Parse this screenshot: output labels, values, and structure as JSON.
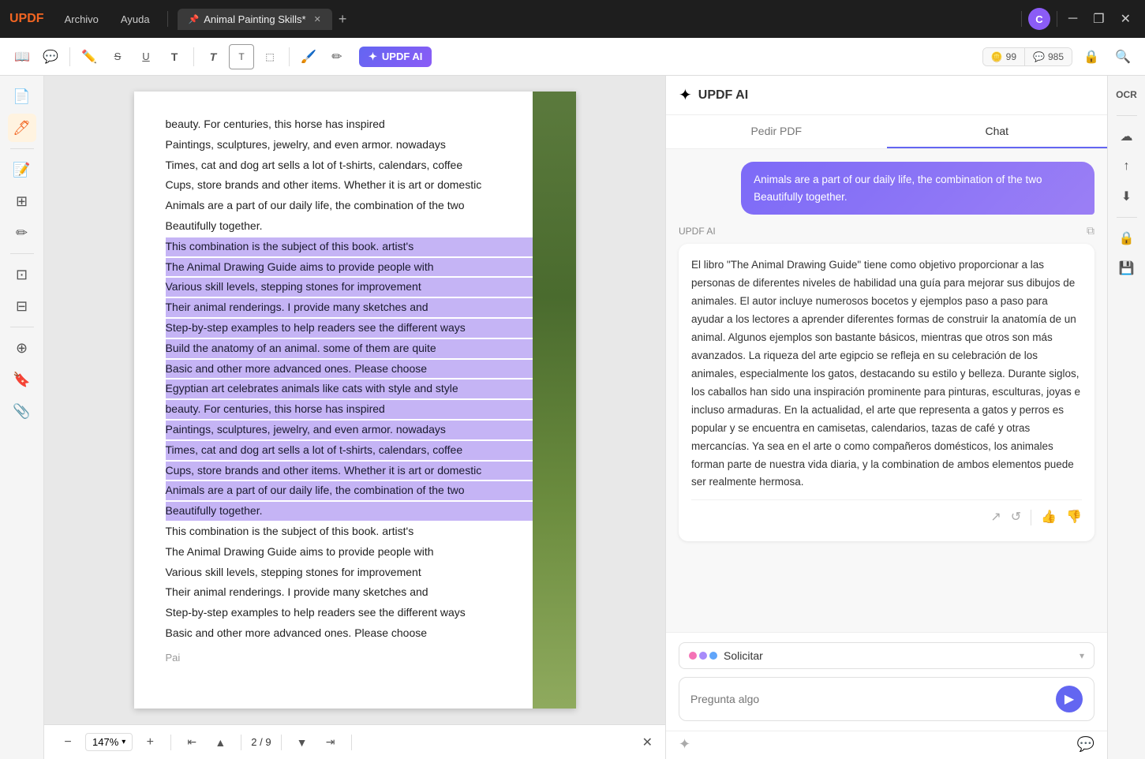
{
  "titleBar": {
    "logo": "UPDF",
    "menus": [
      "Archivo",
      "Ayuda"
    ],
    "tabTitle": "Animal Painting Skills*",
    "avatarLetter": "C"
  },
  "toolbar": {
    "aiLabel": "UPDF AI",
    "badgeCoins": "99",
    "badgeMessages": "985"
  },
  "pdf": {
    "lines": [
      {
        "text": "beauty. For centuries, this horse has inspired",
        "highlighted": false
      },
      {
        "text": "Paintings, sculptures, jewelry, and even armor. nowadays",
        "highlighted": false
      },
      {
        "text": "Times, cat and dog art sells a lot of t-shirts, calendars, coffee",
        "highlighted": false
      },
      {
        "text": "Cups, store brands and other items. Whether it is art or domestic",
        "highlighted": false
      },
      {
        "text": "Animals are a part of our daily life, the combination of the two",
        "highlighted": false
      },
      {
        "text": "Beautifully together.",
        "highlighted": false
      },
      {
        "text": "This combination is the subject of this book. artist's",
        "highlighted": true
      },
      {
        "text": "The Animal Drawing Guide aims to provide people with",
        "highlighted": true
      },
      {
        "text": "Various skill levels, stepping stones for improvement",
        "highlighted": true
      },
      {
        "text": "Their animal renderings. I provide many sketches and",
        "highlighted": true
      },
      {
        "text": "Step-by-step examples to help readers see the different ways",
        "highlighted": true
      },
      {
        "text": "Build the anatomy of an animal. some of them are quite",
        "highlighted": true
      },
      {
        "text": "Basic and other more advanced ones. Please choose",
        "highlighted": true
      },
      {
        "text": "Egyptian art celebrates animals like cats with style and style",
        "highlighted": true
      },
      {
        "text": "beauty. For centuries, this horse has inspired",
        "highlighted": true
      },
      {
        "text": "Paintings, sculptures, jewelry, and even armor. nowadays",
        "highlighted": true
      },
      {
        "text": "Times, cat and dog art sells a lot of t-shirts, calendars, coffee",
        "highlighted": true
      },
      {
        "text": "Cups, store brands and other items. Whether it is art or domestic",
        "highlighted": true
      },
      {
        "text": "Animals are a part of our daily life, the combination of the two",
        "highlighted": true
      },
      {
        "text": "Beautifully together.",
        "highlighted": true
      },
      {
        "text": "This combination is the subject of this book. artist's",
        "highlighted": false
      },
      {
        "text": "The Animal Drawing Guide aims to provide people with",
        "highlighted": false
      },
      {
        "text": "Various skill levels, stepping stones for improvement",
        "highlighted": false
      },
      {
        "text": "Their animal renderings. I provide many sketches and",
        "highlighted": false
      },
      {
        "text": "Step-by-step examples to help readers see the different ways",
        "highlighted": false
      },
      {
        "text": "Basic and other more advanced ones. Please choose",
        "highlighted": false
      }
    ],
    "zoomLevel": "147%",
    "currentPage": "2",
    "totalPages": "9",
    "footerNote": "Pai"
  },
  "aiPanel": {
    "title": "UPDF AI",
    "tabs": [
      "Pedir PDF",
      "Chat"
    ],
    "activeTab": "Chat",
    "userMessage": "Animals are a part of our daily life, the combination of the two Beautifully together.",
    "aiLabel": "UPDF AI",
    "aiResponse": "El libro \"The Animal Drawing Guide\" tiene como objetivo proporcionar a las personas de diferentes niveles de habilidad una guía para mejorar sus dibujos de animales. El autor incluye numerosos bocetos y ejemplos paso a paso para ayudar a los lectores a aprender diferentes formas de construir la anatomía de un animal. Algunos ejemplos son bastante básicos, mientras que otros son más avanzados. La riqueza del arte egipcio se refleja en su celebración de los animales, especialmente los gatos, destacando su estilo y belleza. Durante siglos, los caballos han sido una inspiración prominente para pinturas, esculturas, joyas e incluso armaduras. En la actualidad, el arte que representa a gatos y perros es popular y se encuentra en camisetas, calendarios, tazas de café y otras mercancías. Ya sea en el arte o como compañeros domésticos, los animales forman parte de nuestra vida diaria, y la combination de ambos elementos puede ser realmente hermosa.",
    "solicitarLabel": "Solicitar",
    "inputPlaceholder": "Pregunta algo"
  }
}
